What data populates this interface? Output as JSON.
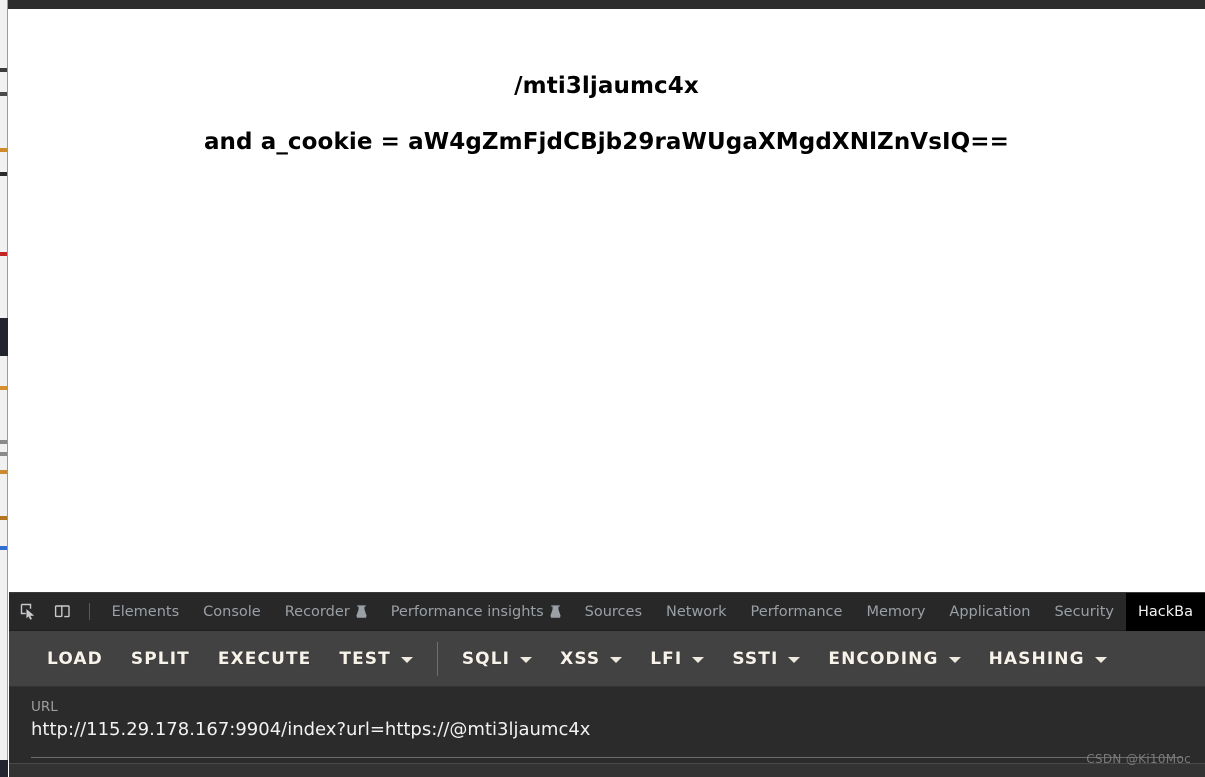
{
  "window": {
    "top_strip_color": "#2e2e2e"
  },
  "page": {
    "line1": "/mti3ljaumc4x",
    "line2": "and a_cookie = aW4gZmFjdCBjb29raWUgaXMgdXNlZnVsIQ=="
  },
  "devtools": {
    "icons": [
      {
        "name": "inspect-element-icon",
        "label": "inspect-element-icon"
      },
      {
        "name": "device-toolbar-icon",
        "label": "device-toolbar-icon"
      }
    ],
    "tabs": [
      {
        "label": "Elements",
        "experimental": false,
        "active": false
      },
      {
        "label": "Console",
        "experimental": false,
        "active": false
      },
      {
        "label": "Recorder",
        "experimental": true,
        "active": false
      },
      {
        "label": "Performance insights",
        "experimental": true,
        "active": false
      },
      {
        "label": "Sources",
        "experimental": false,
        "active": false
      },
      {
        "label": "Network",
        "experimental": false,
        "active": false
      },
      {
        "label": "Performance",
        "experimental": false,
        "active": false
      },
      {
        "label": "Memory",
        "experimental": false,
        "active": false
      },
      {
        "label": "Application",
        "experimental": false,
        "active": false
      },
      {
        "label": "Security",
        "experimental": false,
        "active": false
      },
      {
        "label": "HackBa",
        "experimental": false,
        "active": true
      }
    ],
    "tab_inactive_color": "#9aa0a6",
    "tab_active_bg": "#000000"
  },
  "hackbar": {
    "buttons": [
      {
        "label": "LOAD",
        "has_caret": false
      },
      {
        "label": "SPLIT",
        "has_caret": false
      },
      {
        "label": "EXECUTE",
        "has_caret": false
      },
      {
        "label": "TEST",
        "has_caret": true
      },
      {
        "label": "SQLI",
        "has_caret": true
      },
      {
        "label": "XSS",
        "has_caret": true
      },
      {
        "label": "LFI",
        "has_caret": true
      },
      {
        "label": "SSTI",
        "has_caret": true
      },
      {
        "label": "ENCODING",
        "has_caret": true
      },
      {
        "label": "HASHING",
        "has_caret": true
      }
    ],
    "separator_after_index": 3,
    "toolbar_color": "#424242",
    "url_field": {
      "label": "URL",
      "value": "http://115.29.178.167:9904/index?url=https://@mti3ljaumc4x",
      "placeholder": "URL"
    }
  },
  "watermark": {
    "text": "CSDN @Ki10Moc"
  }
}
